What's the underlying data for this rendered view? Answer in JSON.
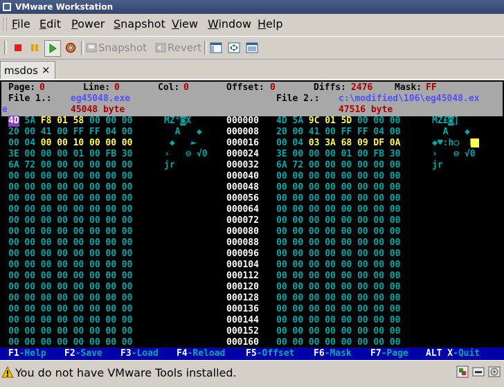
{
  "window": {
    "title": "VMware Workstation"
  },
  "menu": [
    "File",
    "Edit",
    "Power",
    "Snapshot",
    "View",
    "Window",
    "Help"
  ],
  "toolbar": {
    "snapshot_label": "Snapshot",
    "revert_label": "Revert"
  },
  "tab": {
    "label": "msdos",
    "close": "×"
  },
  "screen": {
    "status": {
      "page_label": "Page:",
      "page": "0",
      "line_label": "Line:",
      "line": "0",
      "col_label": "Col:",
      "col": "0",
      "offset_label": "Offset:",
      "offset": "0",
      "diffs_label": "Diffs:",
      "diffs": "2476",
      "mask_label": "Mask:",
      "mask": "FF"
    },
    "file1": {
      "label": "File 1.:",
      "name": "eg45048.exe",
      "name_tail": "e",
      "size": "45048 byte"
    },
    "file2": {
      "label": "File 2.:",
      "name": "c:\\modified\\106\\eg45048.ex",
      "size": "47516 byte"
    },
    "left_rows": [
      "4D 5A F8 01 58 00 00 00",
      "20 00 41 00 FF FF 04 00",
      "00 04 00 00 10 00 00 00",
      "3E 00 00 00 01 00 FB 30",
      "6A 72 00 00 00 00 00 00",
      "00 00 00 00 00 00 00 00",
      "00 00 00 00 00 00 00 00",
      "00 00 00 00 00 00 00 00",
      "00 00 00 00 00 00 00 00",
      "00 00 00 00 00 00 00 00",
      "00 00 00 00 00 00 00 00",
      "00 00 00 00 00 00 00 00",
      "00 00 00 00 00 00 00 00",
      "00 00 00 00 00 00 00 00",
      "00 00 00 00 00 00 00 00",
      "00 00 00 00 00 00 00 00",
      "00 00 00 00 00 00 00 00",
      "00 00 00 00 00 00 00 00",
      "00 00 00 00 00 00 00 00",
      "00 00 00 00 00 00 00 00",
      "00 00 00 00 00 00 00 00"
    ],
    "left_ascii": [
      "MZ°◙X",
      "  A   ◆",
      " ◆   ►",
      "›   ⊖ √0",
      "jr"
    ],
    "offsets": [
      "000000",
      "000008",
      "000016",
      "000024",
      "000032",
      "000040",
      "000048",
      "000056",
      "000064",
      "000072",
      "000080",
      "000088",
      "000096",
      "000104",
      "000112",
      "000120",
      "000128",
      "000136",
      "000144",
      "000152",
      "000160"
    ],
    "right_rows": [
      "4D 5A 9C 01 5D 00 00 00",
      "20 00 41 00 FF FF 04 00",
      "00 04 03 3A 68 09 DF 0A",
      "3E 00 00 00 01 00 FB 30",
      "6A 72 00 00 00 00 00 00",
      "00 00 00 00 00 00 00 00",
      "00 00 00 00 00 00 00 00",
      "00 00 00 00 00 00 00 00",
      "00 00 00 00 00 00 00 00",
      "00 00 00 00 00 00 00 00",
      "00 00 00 00 00 00 00 00",
      "00 00 00 00 00 00 00 00",
      "00 00 00 00 00 00 00 00",
      "00 00 00 00 00 00 00 00",
      "00 00 00 00 00 00 00 00",
      "00 00 00 00 00 00 00 00",
      "00 00 00 00 00 00 00 00",
      "00 00 00 00 00 00 00 00",
      "00 00 00 00 00 00 00 00",
      "00 00 00 00 00 00 00 00",
      "00 00 00 00 00 00 00 00"
    ],
    "right_ascii": [
      "MZ£◙]",
      "  A   ◆",
      "◆♥:h○  ◘",
      "›   ⊖ √0",
      "jr"
    ],
    "fkeys": [
      {
        "k": "F1",
        "l": "-Help"
      },
      {
        "k": "F2",
        "l": "-Save"
      },
      {
        "k": "F3",
        "l": "-Load"
      },
      {
        "k": "F4",
        "l": "-Reload"
      },
      {
        "k": "F5",
        "l": "-Offset"
      },
      {
        "k": "F6",
        "l": "-Mask"
      },
      {
        "k": "F7",
        "l": "-Page"
      },
      {
        "k": "ALT X",
        "l": "-Quit"
      }
    ]
  },
  "statusbar": {
    "message": "You do not have VMware Tools installed."
  },
  "colors": {
    "highlight": "#ffff50",
    "diff_bg": "#8b3fbf",
    "hex": "#00a8a8",
    "fkey_bar": "#0000a8"
  }
}
